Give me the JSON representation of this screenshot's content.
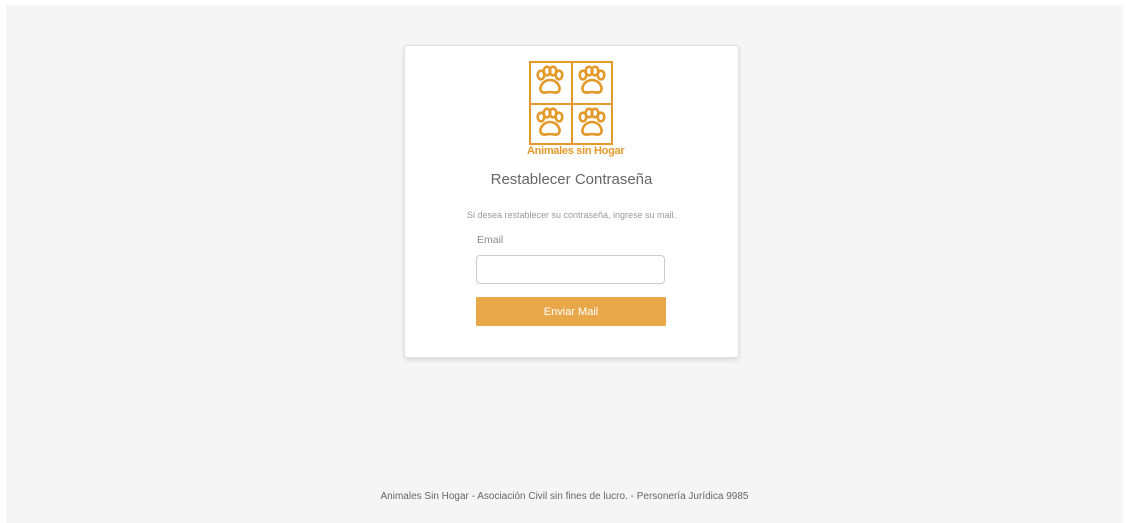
{
  "logo": {
    "icon": "paw-print-icon",
    "text": "Animales sin Hogar",
    "color": "#e39a2a"
  },
  "form": {
    "title": "Restablecer Contraseña",
    "description": "Si desea restablecer su contraseña, ingrese su mail.",
    "email_label": "Email",
    "email_value": "",
    "submit_label": "Enviar Mail",
    "button_color": "#e8a84a"
  },
  "footer": {
    "text": "Animales Sin Hogar - Asociación Civil sin fines de lucro. - Personería Jurídica 9985"
  }
}
